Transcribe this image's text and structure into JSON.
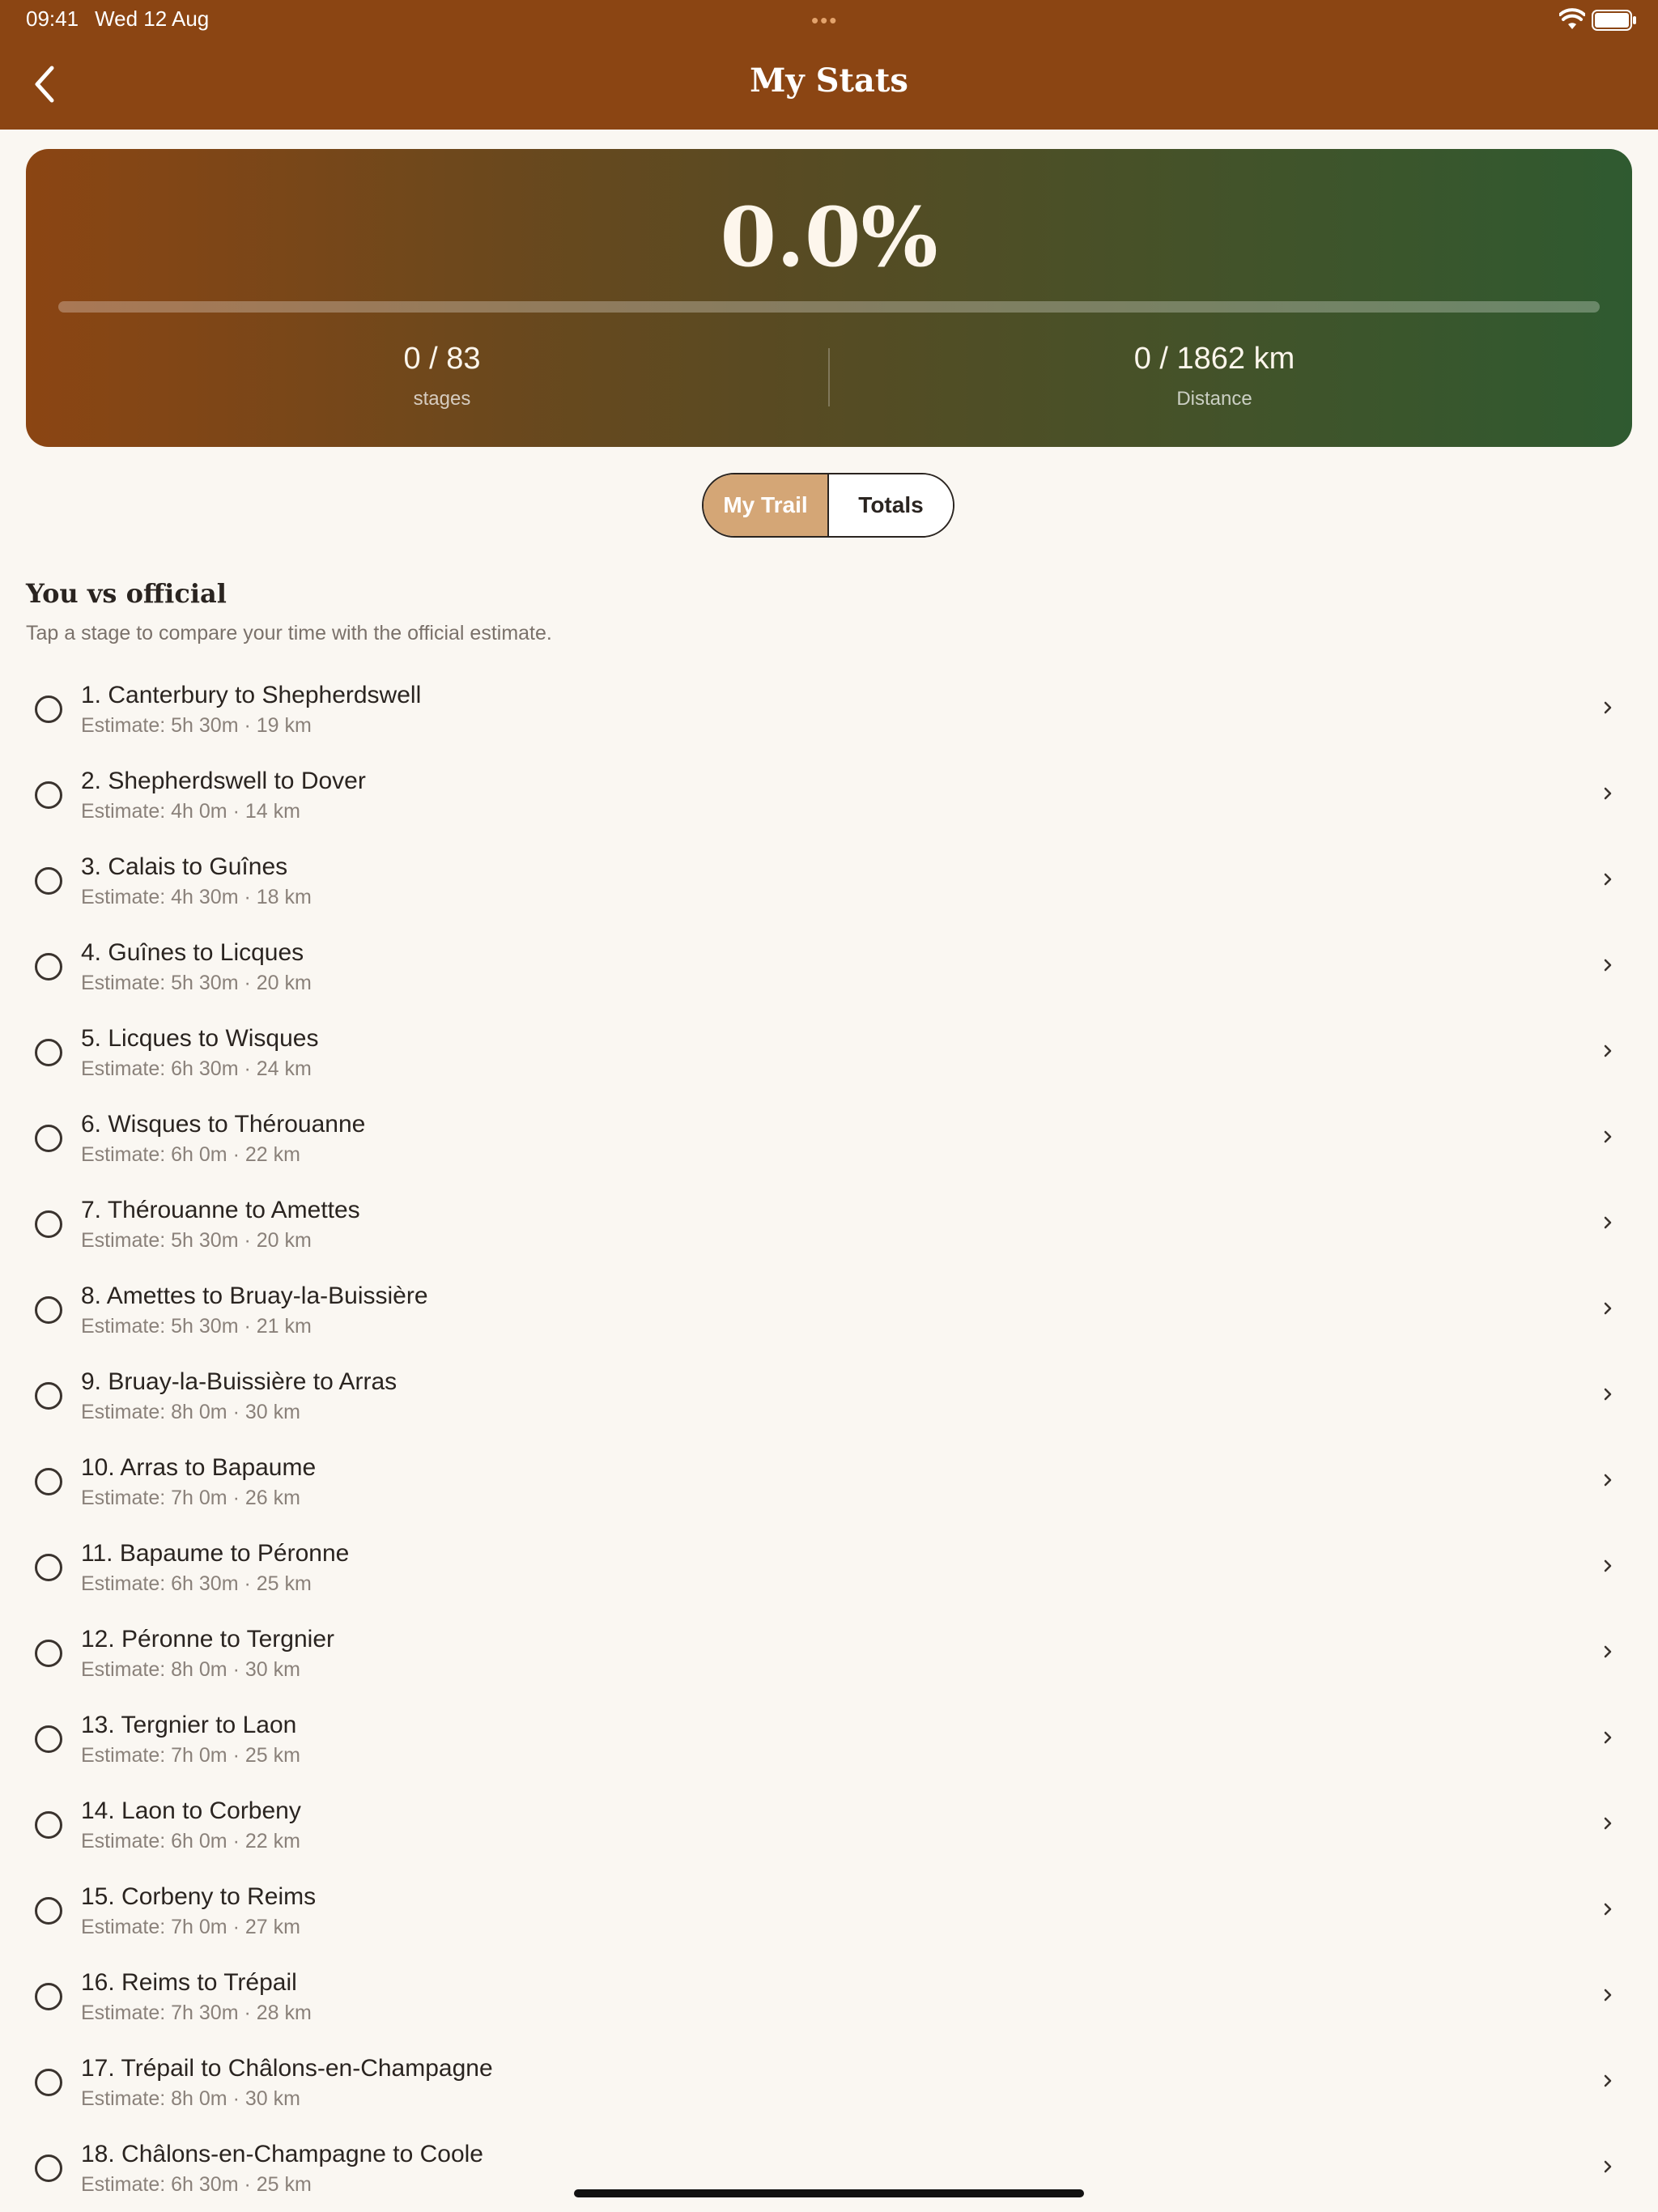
{
  "status_bar": {
    "time": "09:41",
    "date": "Wed 12 Aug",
    "multitask_dots": "•••"
  },
  "nav": {
    "title": "My Stats",
    "back_icon": "chevron-left-icon"
  },
  "progress": {
    "percent_text": "0.0%",
    "fraction": 0.0,
    "stages_value": "0 / 83",
    "stages_label": "stages",
    "distance_value": "0 / 1862 km",
    "distance_label": "Distance"
  },
  "segments": {
    "my_trail": "My Trail",
    "totals": "Totals",
    "selected": "My Trail"
  },
  "section": {
    "title": "You vs official",
    "subtitle": "Tap a stage to compare your time with the official estimate."
  },
  "stages": [
    {
      "name": "1. Canterbury to Shepherdswell",
      "estimate": "Estimate: 5h 30m · 19 km"
    },
    {
      "name": "2. Shepherdswell to Dover",
      "estimate": "Estimate: 4h 0m · 14 km"
    },
    {
      "name": "3. Calais to Guînes",
      "estimate": "Estimate: 4h 30m · 18 km"
    },
    {
      "name": "4. Guînes to Licques",
      "estimate": "Estimate: 5h 30m · 20 km"
    },
    {
      "name": "5. Licques to Wisques",
      "estimate": "Estimate: 6h 30m · 24 km"
    },
    {
      "name": "6. Wisques to Thérouanne",
      "estimate": "Estimate: 6h 0m · 22 km"
    },
    {
      "name": "7. Thérouanne to Amettes",
      "estimate": "Estimate: 5h 30m · 20 km"
    },
    {
      "name": "8. Amettes to Bruay-la-Buissière",
      "estimate": "Estimate: 5h 30m · 21 km"
    },
    {
      "name": "9. Bruay-la-Buissière to Arras",
      "estimate": "Estimate: 8h 0m · 30 km"
    },
    {
      "name": "10. Arras to Bapaume",
      "estimate": "Estimate: 7h 0m · 26 km"
    },
    {
      "name": "11. Bapaume to Péronne",
      "estimate": "Estimate: 6h 30m · 25 km"
    },
    {
      "name": "12. Péronne to Tergnier",
      "estimate": "Estimate: 8h 0m · 30 km"
    },
    {
      "name": "13. Tergnier to Laon",
      "estimate": "Estimate: 7h 0m · 25 km"
    },
    {
      "name": "14. Laon to Corbeny",
      "estimate": "Estimate: 6h 0m · 22 km"
    },
    {
      "name": "15. Corbeny to Reims",
      "estimate": "Estimate: 7h 0m · 27 km"
    },
    {
      "name": "16. Reims to Trépail",
      "estimate": "Estimate: 7h 30m · 28 km"
    },
    {
      "name": "17. Trépail to Châlons-en-Champagne",
      "estimate": "Estimate: 8h 0m · 30 km"
    },
    {
      "name": "18. Châlons-en-Champagne to Coole",
      "estimate": "Estimate: 6h 30m · 25 km"
    }
  ],
  "colors": {
    "header": "#8b4513",
    "card_start": "#8b4513",
    "card_end": "#2f5a30",
    "segment_active": "#d4a676",
    "background": "#faf7f2"
  }
}
